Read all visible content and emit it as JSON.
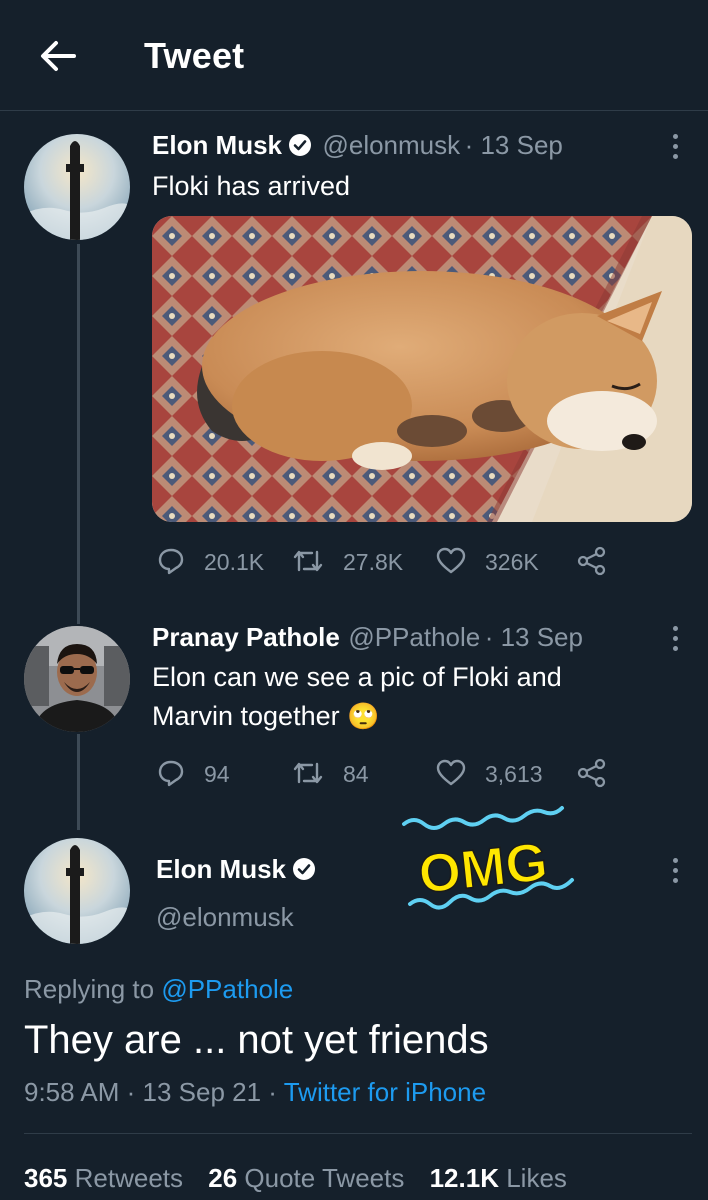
{
  "header": {
    "title": "Tweet"
  },
  "tweet1": {
    "name": "Elon Musk",
    "handle": "@elonmusk",
    "date": "· 13 Sep",
    "text": "Floki has arrived",
    "replies": "20.1K",
    "retweets": "27.8K",
    "likes": "326K"
  },
  "tweet2": {
    "name": "Pranay Pathole",
    "handle": "@PPathole",
    "date": "· 13 Sep",
    "text_line1": "Elon can we see a pic of Floki and",
    "text_line2": "Marvin together",
    "emoji": "🙄",
    "replies": "94",
    "retweets": "84",
    "likes": "3,613"
  },
  "overlay": {
    "text": "OMG"
  },
  "main_tweet": {
    "name": "Elon Musk",
    "handle": "@elonmusk",
    "replying_prefix": "Replying to",
    "replying_to": "@PPathole",
    "text": "They are ... not yet friends",
    "time": "9:58 AM",
    "date": "13 Sep 21",
    "source": "Twitter for iPhone",
    "retweets_count": "365",
    "retweets_label": "Retweets",
    "quotes_count": "26",
    "quotes_label": "Quote Tweets",
    "likes_count": "12.1K",
    "likes_label": "Likes"
  },
  "colors": {
    "background": "#15202b",
    "link": "#1d9bf0",
    "muted": "#8b98a5",
    "overlay": "#ffe600"
  }
}
